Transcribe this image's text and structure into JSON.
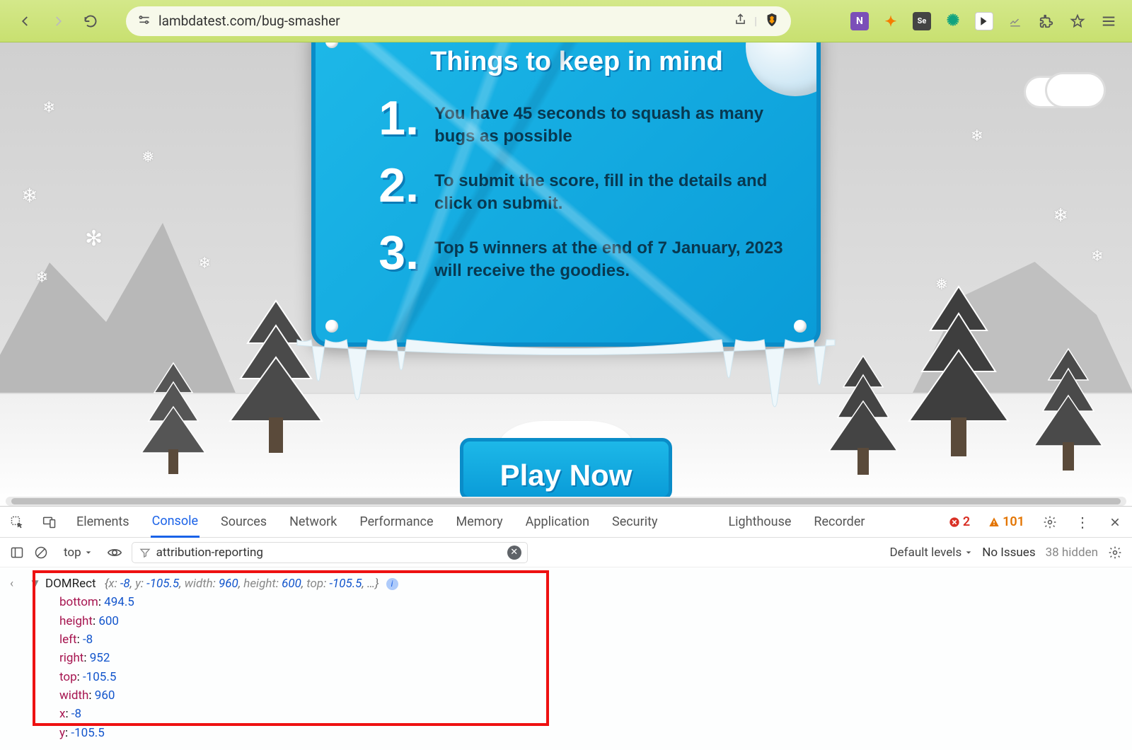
{
  "browser": {
    "url": "lambdatest.com/bug-smasher"
  },
  "game": {
    "title": "Things to keep in mind",
    "rules": [
      {
        "n": "1.",
        "t": "You have 45 seconds to squash as many bugs as possible"
      },
      {
        "n": "2.",
        "t": "To submit the score, fill in the details and click on submit."
      },
      {
        "n": "3.",
        "t": "Top 5 winners at the end of 7 January, 2023 will receive the goodies."
      }
    ],
    "play": "Play Now"
  },
  "devtools": {
    "tabs": [
      "Elements",
      "Console",
      "Sources",
      "Network",
      "Performance",
      "Memory",
      "Application",
      "Security",
      "Lighthouse",
      "Recorder"
    ],
    "active_tab": "Console",
    "errors": "2",
    "warnings": "101",
    "context": "top",
    "filter_value": "attribution-reporting",
    "levels_label": "Default levels",
    "no_issues": "No Issues",
    "hidden_label": "38 hidden"
  },
  "console": {
    "class": "DOMRect",
    "inline": "{x: -8, y: -105.5, width: 960, height: 600, top: -105.5, …}",
    "props": [
      {
        "k": "bottom",
        "v": "494.5"
      },
      {
        "k": "height",
        "v": "600"
      },
      {
        "k": "left",
        "v": "-8"
      },
      {
        "k": "right",
        "v": "952"
      },
      {
        "k": "top",
        "v": "-105.5"
      },
      {
        "k": "width",
        "v": "960"
      },
      {
        "k": "x",
        "v": "-8"
      },
      {
        "k": "y",
        "v": "-105.5"
      }
    ]
  }
}
